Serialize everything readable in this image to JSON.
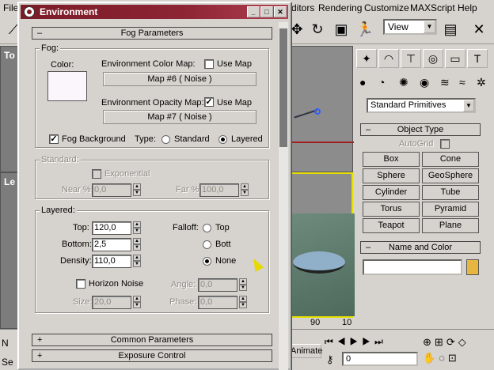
{
  "menubar": {
    "file": "File",
    "editors": "ditors",
    "rendering": "Rendering",
    "customize": "Customize",
    "maxscript": "MAXScript",
    "help": "Help"
  },
  "toolbar": {
    "view_select": "View"
  },
  "viewports": {
    "top_label": "To",
    "left_label": "Le",
    "ruler_90": "90",
    "ruler_100": "10"
  },
  "command_panel": {
    "category_dropdown": "Standard Primitives",
    "object_type": {
      "header": "Object Type",
      "autogrid": "AutoGrid",
      "buttons": [
        "Box",
        "Cone",
        "Sphere",
        "GeoSphere",
        "Cylinder",
        "Tube",
        "Torus",
        "Pyramid",
        "Teapot",
        "Plane"
      ]
    },
    "name_color": {
      "header": "Name and Color",
      "name_value": "",
      "swatch_color": "#e6b640"
    }
  },
  "bottombar": {
    "animate": "Animate",
    "frame_value": "0",
    "left_fragment": "N",
    "sel_fragment": "Se"
  },
  "dialog": {
    "title": "Environment",
    "fog_rollout": {
      "header": "Fog Parameters",
      "fog_group": "Fog:",
      "color_label": "Color:",
      "color_swatch": "#fbf6fb",
      "env_color_map_label": "Environment Color Map:",
      "use_map_1": "Use Map",
      "map1": "Map #6  ( Noise )",
      "env_opacity_map_label": "Environment Opacity Map:",
      "use_map_2": "Use Map",
      "map2": "Map #7  ( Noise )",
      "fog_background": "Fog Background",
      "type_label": "Type:",
      "type_standard": "Standard",
      "type_layered": "Layered"
    },
    "standard_group": {
      "label": "Standard:",
      "exponential": "Exponential",
      "near_label": "Near %:",
      "near_value": "0,0",
      "far_label": "Far %:",
      "far_value": "100,0"
    },
    "layered_group": {
      "label": "Layered:",
      "top_label": "Top:",
      "top_value": "120,0",
      "bottom_label": "Bottom:",
      "bottom_value": "2,5",
      "density_label": "Density:",
      "density_value": "110,0",
      "falloff_label": "Falloff:",
      "falloff_top": "Top",
      "falloff_bottom": "Bott",
      "falloff_none": "None",
      "horizon_noise": "Horizon Noise",
      "size_label": "Size:",
      "size_value": "20,0",
      "angle_label": "Angle:",
      "angle_value": "0,0",
      "phase_label": "Phase:",
      "phase_value": "0,0"
    },
    "common_rollout": "Common Parameters",
    "exposure_rollout": "Exposure Control"
  }
}
